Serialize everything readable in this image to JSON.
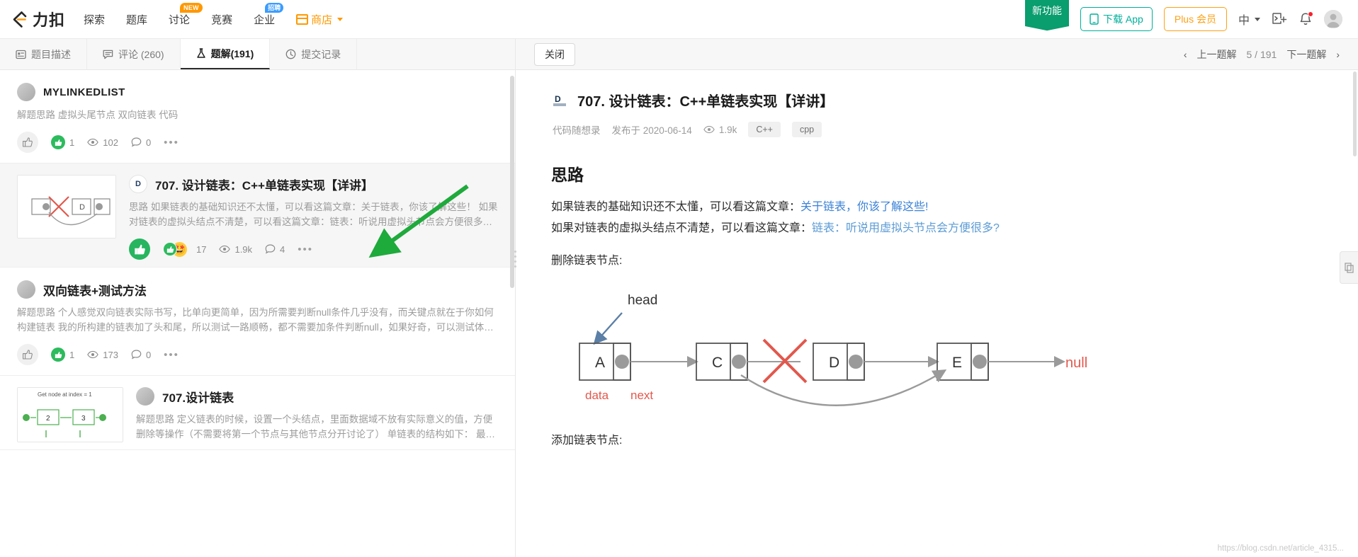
{
  "nav": {
    "logo_text": "力扣",
    "links": [
      {
        "label": "探索",
        "badge": null
      },
      {
        "label": "题库",
        "badge": null
      },
      {
        "label": "讨论",
        "badge": "NEW"
      },
      {
        "label": "竞赛",
        "badge": null
      },
      {
        "label": "企业",
        "badge": "招聘"
      }
    ],
    "shop_label": "商店",
    "ribbon_label": "新功能",
    "download_label": "下载 App",
    "plus_label": "Plus 会员",
    "lang_label": "中",
    "icons": [
      "playground-icon",
      "notification-bell-icon",
      "user-avatar"
    ]
  },
  "left_tabs": [
    {
      "label": "题目描述",
      "icon": "description-icon",
      "active": false
    },
    {
      "label": "评论 (260)",
      "icon": "comment-icon",
      "active": false
    },
    {
      "label": "题解(191)",
      "icon": "flask-icon",
      "active": true
    },
    {
      "label": "提交记录",
      "icon": "clock-icon",
      "active": false
    }
  ],
  "right_header": {
    "close_label": "关闭",
    "prev_label": "上一题解",
    "counter": "5 / 191",
    "next_label": "下一题解"
  },
  "solutions": [
    {
      "author": "MYLINKEDLIST",
      "title": null,
      "excerpt": "解题思路 虚拟头尾节点 双向链表 代码",
      "likes": "1",
      "views": "102",
      "comments": "0",
      "selected": false,
      "has_thumbnail": false
    },
    {
      "author": null,
      "title": "707. 设计链表：C++单链表实现【详讲】",
      "excerpt": "思路 如果链表的基础知识还不太懂，可以看这篇文章：关于链表，你该了解这些！ 如果对链表的虚拟头结点不清楚，可以看这篇文章：链表：听说用虚拟头节点会方便很多？ 删...",
      "reactions": "17",
      "views": "1.9k",
      "comments": "4",
      "selected": true,
      "has_thumbnail": true
    },
    {
      "author": "双向链表+测试方法",
      "title": null,
      "excerpt": "解题思路 个人感觉双向链表实际书写，比单向更简单，因为所需要判断null条件几乎没有，而关键点就在于你如何构建链表 我的所构建的链表加了头和尾，所以测试一路顺畅，都不需要加条件判断null，如果好奇，可以测试体验下，...",
      "likes": "1",
      "views": "173",
      "comments": "0",
      "selected": false,
      "has_thumbnail": false
    },
    {
      "author": null,
      "title": "707.设计链表",
      "excerpt": "解题思路 定义链表的时候，设置一个头结点，里面数据域不放有实际意义的值，方便删除等操作（不需要将第一个节点与其他节点分开讨论了） 单链表的结构如下： 最前面有个...",
      "selected": false,
      "has_thumbnail": true,
      "thumb_caption": "Get node at index = 1"
    }
  ],
  "article": {
    "title": "707. 设计链表：C++单链表实现【详讲】",
    "author": "代码随想录",
    "published": "发布于 2020-06-14",
    "views": "1.9k",
    "tags": [
      "C++",
      "cpp"
    ],
    "section_heading": "思路",
    "para1_a": "如果链表的基础知识还不太懂，可以看这篇文章：",
    "para1_link": "关于链表，你该了解这些!",
    "para2_a": "如果对链表的虚拟头结点不清楚，可以看这篇文章：",
    "para2_link": "链表：听说用虚拟头节点会方便很多?",
    "para3": "删除链表节点:",
    "para4": "添加链表节点:",
    "figure": {
      "head_label": "head",
      "nodes": [
        "A",
        "C",
        "D",
        "E"
      ],
      "null_label": "null",
      "data_label": "data",
      "next_label": "next"
    },
    "watermark": "https://blog.csdn.net/article_4315..."
  }
}
